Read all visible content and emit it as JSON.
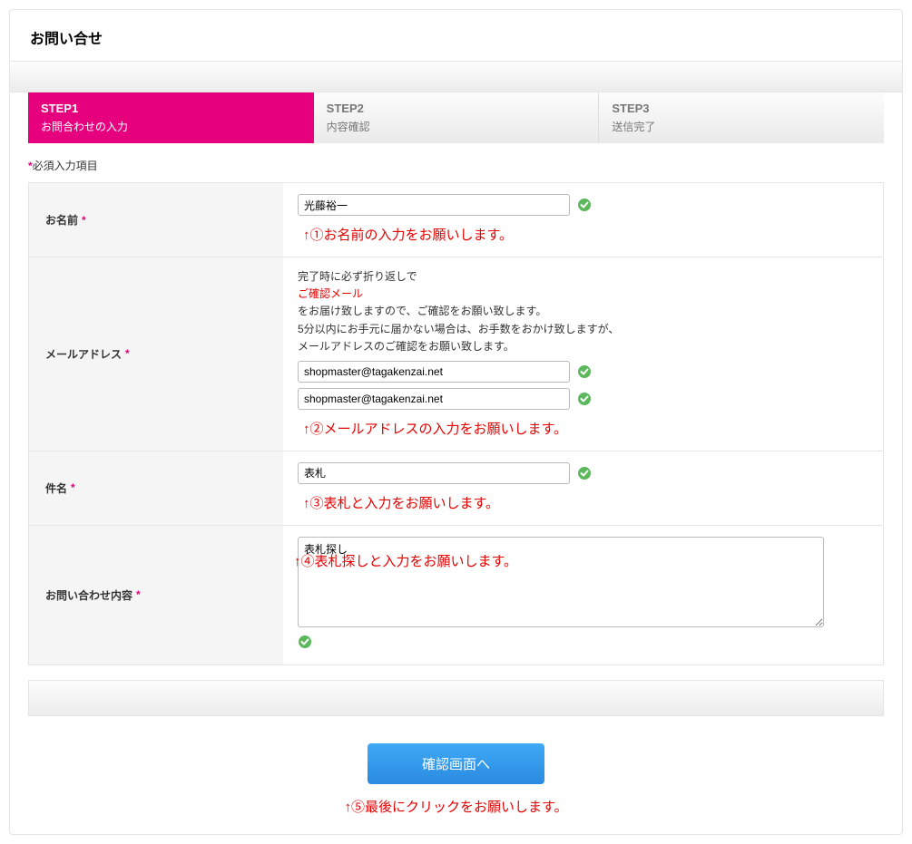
{
  "header": {
    "title": "お問い合せ"
  },
  "steps": [
    {
      "title": "STEP1",
      "sub": "お問合わせの入力",
      "active": true
    },
    {
      "title": "STEP2",
      "sub": "内容確認",
      "active": false
    },
    {
      "title": "STEP3",
      "sub": "送信完了",
      "active": false
    }
  ],
  "required_note": {
    "asterisk": "*",
    "text": "必須入力項目"
  },
  "fields": {
    "name": {
      "label": "お名前",
      "asterisk": "*",
      "value": "光藤裕一",
      "annot": "↑①お名前の入力をお願いします。"
    },
    "email": {
      "label": "メールアドレス",
      "asterisk": "*",
      "info_line1": "完了時に必ず折り返しで",
      "info_red": "ご確認メール",
      "info_line2": "をお届け致しますので、ご確認をお願い致します。",
      "info_line3": "5分以内にお手元に届かない場合は、お手数をおかけ致しますが、",
      "info_line4": "メールアドレスのご確認をお願い致します。",
      "value1": "shopmaster@tagakenzai.net",
      "value2": "shopmaster@tagakenzai.net",
      "annot": "↑②メールアドレスの入力をお願いします。"
    },
    "subject": {
      "label": "件名",
      "asterisk": "*",
      "value": "表札",
      "annot": "↑③表札と入力をお願いします。"
    },
    "body": {
      "label": "お問い合わせ内容",
      "asterisk": "*",
      "value": "表札探し",
      "annot": "↑④表札探しと入力をお願いします。"
    }
  },
  "submit": {
    "label": "確認画面へ",
    "annot": "↑⑤最後にクリックをお願いします。"
  }
}
